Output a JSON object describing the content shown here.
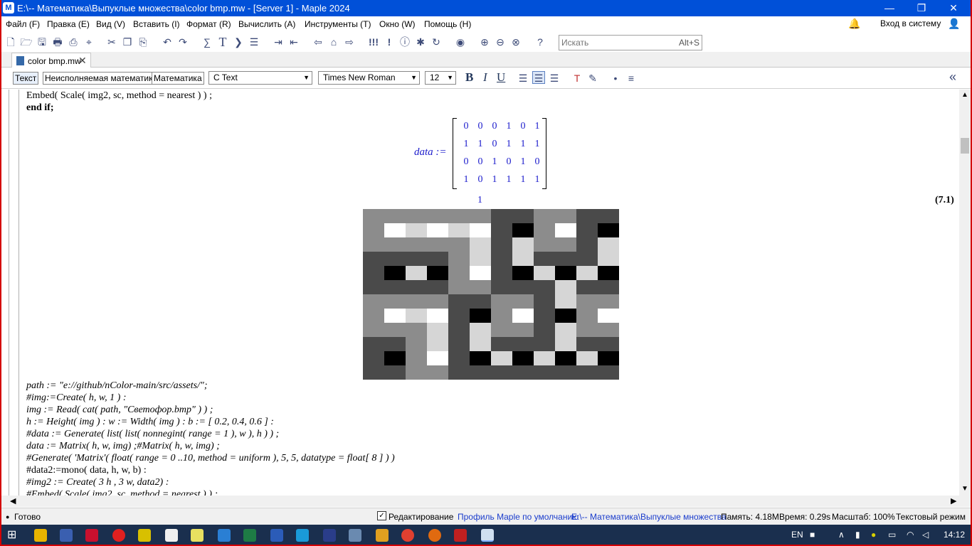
{
  "window": {
    "title": "E:\\-- Математика\\Выпуклые множества\\color bmp.mw - [Server 1] - Maple 2024",
    "minimize": "—",
    "restore": "❐",
    "close": "✕"
  },
  "menu": {
    "items": [
      "Файл (F)",
      "Правка (E)",
      "Вид (V)",
      "Вставить (I)",
      "Формат (R)",
      "Вычислить (A)",
      "Инструменты (T)",
      "Окно (W)",
      "Помощь (H)"
    ],
    "signin": "Вход в систему"
  },
  "search": {
    "placeholder": "Искать",
    "shortcut": "Alt+S"
  },
  "tab": {
    "label": "color bmp.mw",
    "close": "✕"
  },
  "format_toolbar": {
    "text_btn": "Текст",
    "nonexec_btn": "Неисполняемая математика",
    "math_btn": "Математика",
    "style": "C  Text",
    "font": "Times New Roman",
    "size": "12",
    "bold": "B",
    "italic": "I",
    "underline": "U"
  },
  "document": {
    "top_lines": [
      "Embed( Scale( img2, sc, method = nearest ) ) ;",
      "end if;"
    ],
    "output": {
      "label": "data :=",
      "matrix": [
        [
          0,
          0,
          0,
          1,
          0,
          1
        ],
        [
          1,
          1,
          0,
          1,
          1,
          1
        ],
        [
          0,
          0,
          1,
          0,
          1,
          0
        ],
        [
          1,
          0,
          1,
          1,
          1,
          1
        ]
      ],
      "extra": "1",
      "equation_label": "(7.1)"
    },
    "image_grid": [
      [
        2,
        2,
        2,
        2,
        2,
        2,
        1,
        1,
        2,
        2,
        1,
        1
      ],
      [
        2,
        4,
        3,
        4,
        3,
        4,
        1,
        0,
        2,
        4,
        1,
        0
      ],
      [
        2,
        2,
        2,
        2,
        2,
        3,
        1,
        3,
        2,
        2,
        1,
        3
      ],
      [
        1,
        1,
        1,
        1,
        2,
        3,
        1,
        3,
        1,
        1,
        1,
        3
      ],
      [
        1,
        0,
        3,
        0,
        2,
        4,
        1,
        0,
        3,
        0,
        3,
        0
      ],
      [
        1,
        1,
        1,
        1,
        2,
        2,
        1,
        1,
        1,
        3,
        1,
        1
      ],
      [
        2,
        2,
        2,
        2,
        1,
        1,
        2,
        2,
        1,
        3,
        2,
        2
      ],
      [
        2,
        4,
        3,
        4,
        1,
        0,
        2,
        4,
        1,
        0,
        2,
        4
      ],
      [
        2,
        2,
        2,
        3,
        1,
        3,
        2,
        2,
        1,
        3,
        2,
        2
      ],
      [
        1,
        1,
        2,
        3,
        1,
        3,
        1,
        1,
        1,
        3,
        1,
        1
      ],
      [
        1,
        0,
        2,
        4,
        1,
        0,
        3,
        0,
        3,
        0,
        3,
        0
      ],
      [
        1,
        1,
        2,
        2,
        1,
        1,
        1,
        1,
        1,
        1,
        1,
        1
      ]
    ],
    "code_lines": [
      "path := \"e://github/nColor-main/src/assets/\";",
      "#img:=Create( h, w, 1 ) :",
      "img := Read( cat( path, \"Светофор.bmp\" ) ) ;",
      "h := Height( img ) : w := Width( img ) : b := [ 0.2, 0.4, 0.6 ] :",
      "#data := Generate( list( list( nonnegint( range = 1 ), w ), h ) ) ;",
      "data := Matrix( h, w, img) ;#Matrix( h, w, img) ;",
      "#Generate( 'Matrix'( float( range = 0 ..10, method = uniform ), 5, 5, datatype = float[ 8 ] ) )",
      "#data2:=mono( data, h, w, b) :",
      "#img2 := Create( 3 h , 3 w, data2) :",
      "#Embed( Scale( img2, sc, method = nearest ) ) ;"
    ]
  },
  "status": {
    "ready": "Готово",
    "editing": "Редактирование",
    "profile": "Профиль Maple по умолчанию",
    "path": "E:\\-- Математика\\Выпуклые множества",
    "memory": "Память: 4.18M",
    "time": "Время: 0.29s",
    "zoom": "Масштаб: 100%",
    "mode": "Текстовый режим"
  },
  "taskbar": {
    "lang": "EN",
    "clock": "14:12"
  },
  "colors": {
    "titlebar": "#0050d8",
    "border": "#d40000",
    "math_blue": "#1c1ccc",
    "taskbar": "#1a2f4e"
  },
  "gray_levels": [
    "#000000",
    "#4a4a4a",
    "#8c8c8c",
    "#d6d6d6",
    "#ffffff"
  ]
}
